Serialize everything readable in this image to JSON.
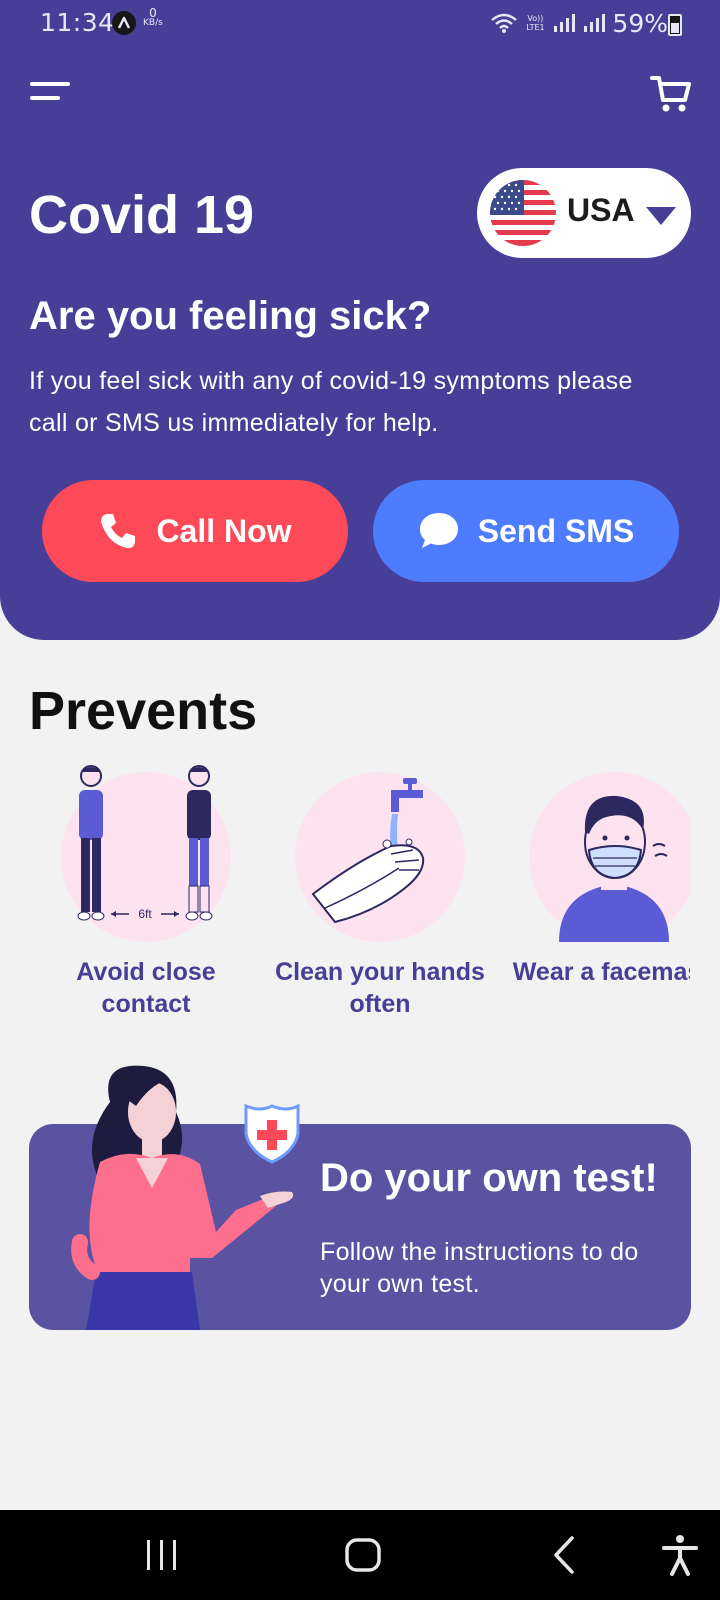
{
  "status_bar": {
    "time": "11:34",
    "network_speed_value": "0",
    "network_speed_unit": "KB/s",
    "volte_label": "Vo)) LTE1",
    "battery_percent": "59%"
  },
  "header": {
    "menu_icon": "menu-icon",
    "cart_icon": "cart-icon",
    "app_title": "Covid 19",
    "country_selector": {
      "flag_icon": "usa-flag-icon",
      "label": "USA",
      "caret_icon": "caret-down-icon"
    },
    "question_title": "Are you feeling sick?",
    "question_text": "If you feel sick with any of covid-19 symptoms please call or SMS us immediately for help.",
    "call_button": {
      "label": "Call Now",
      "icon": "phone-icon",
      "color": "#fe4a58"
    },
    "sms_button": {
      "label": "Send SMS",
      "icon": "chat-bubble-icon",
      "color": "#4e7cff"
    }
  },
  "prevents": {
    "title": "Prevents",
    "items": [
      {
        "label_line1": "Avoid close",
        "label_line2": "contact",
        "illustration_text": "6ft",
        "icon": "distance-illustration"
      },
      {
        "label_line1": "Clean your hands",
        "label_line2": "often",
        "icon": "handwash-illustration"
      },
      {
        "label_line1": "Wear a facemask",
        "label_line2": "",
        "icon": "facemask-illustration"
      }
    ]
  },
  "test_card": {
    "title": "Do your own test!",
    "text": "Follow the instructions to do your own test.",
    "icon": "shield-cross-icon"
  },
  "nav_bar": {
    "recents_icon": "recents-icon",
    "home_icon": "home-icon",
    "back_icon": "back-icon",
    "accessibility_icon": "accessibility-icon"
  },
  "colors": {
    "primary": "#473f97",
    "call": "#fe4a58",
    "sms": "#4e7cff",
    "card": "#5a53a1",
    "prevent_bg": "#fde3ef",
    "background": "#f2f2f2"
  }
}
